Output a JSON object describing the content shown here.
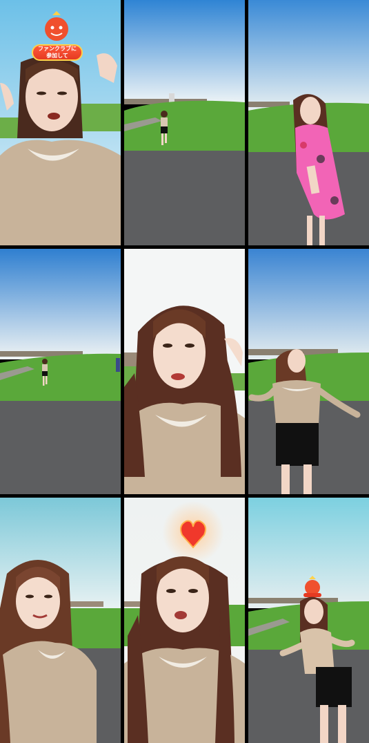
{
  "grid": {
    "tiles": [
      {
        "id": "tile-1",
        "badge_text": "ファンクラブに\n参加して"
      },
      {
        "id": "tile-2"
      },
      {
        "id": "tile-3"
      },
      {
        "id": "tile-4"
      },
      {
        "id": "tile-5"
      },
      {
        "id": "tile-6"
      },
      {
        "id": "tile-7"
      },
      {
        "id": "tile-8"
      },
      {
        "id": "tile-9"
      }
    ]
  },
  "colors": {
    "sky_top": "#4a9de0",
    "sky_bottom": "#e8f2f8",
    "grass": "#5aa83a",
    "road": "#5d5e60",
    "shirt": "#c8b39a",
    "hair": "#4a2a1e",
    "skin": "#f2d6c6",
    "badge_red": "#e53a22",
    "heart_red": "#f0382b"
  }
}
